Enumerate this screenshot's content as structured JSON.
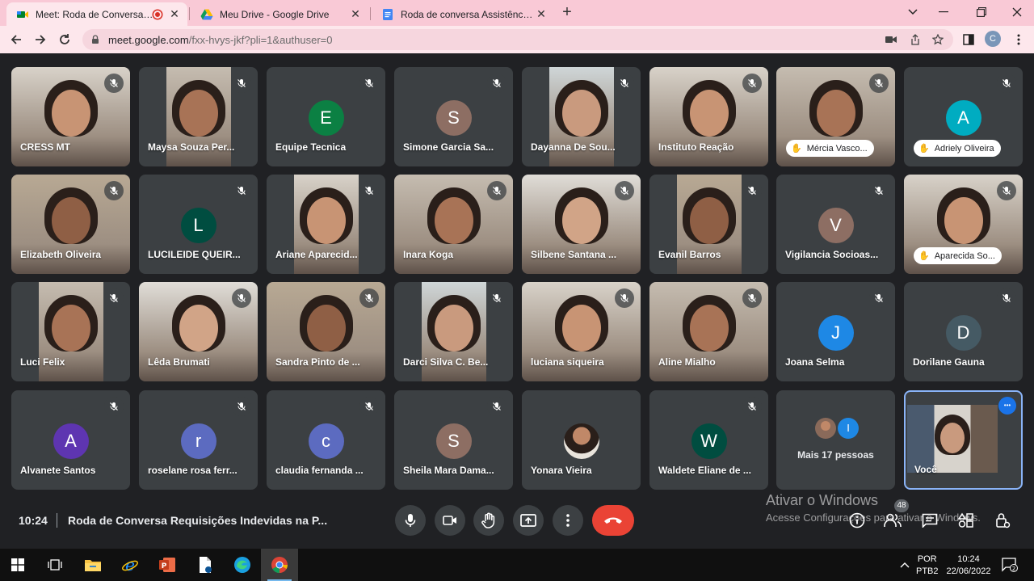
{
  "browser": {
    "tabs": [
      {
        "title": "Meet: Roda de Conversa Req",
        "active": true,
        "recording": true
      },
      {
        "title": "Meu Drive - Google Drive",
        "active": false
      },
      {
        "title": "Roda de conversa Assistência So",
        "active": false
      }
    ],
    "new_tab": "+",
    "url_host": "meet.google.com",
    "url_path": "/fxx-hvys-jkf?pli=1&authuser=0",
    "profile_initial": "C",
    "colors": {
      "tabbar": "#f9c9d6",
      "toolbar": "#fde7ec"
    }
  },
  "meeting": {
    "time": "10:24",
    "title": "Roda de Conversa Requisições Indevidas na P...",
    "people_count": "48",
    "more_people_label": "Mais 17 pessoas",
    "more_people_avatar_letter": "I",
    "self_label": "Você",
    "watermark_title": "Ativar o Windows",
    "watermark_sub": "Acesse Configurações para ativar o Windows."
  },
  "participants": [
    {
      "name": "CRESS MT",
      "type": "video",
      "muted": true
    },
    {
      "name": "Maysa Souza Per...",
      "type": "video",
      "muted": true
    },
    {
      "name": "Equipe Tecnica",
      "type": "initial",
      "initial": "E",
      "color": "#0b8043",
      "muted": true
    },
    {
      "name": "Simone Garcia Sa...",
      "type": "initial",
      "initial": "S",
      "color": "#8d6e63",
      "muted": true
    },
    {
      "name": "Dayanna De Sou...",
      "type": "video",
      "muted": true
    },
    {
      "name": "Instituto Reação",
      "type": "video",
      "muted": true
    },
    {
      "name": "Mércia Vasco...",
      "type": "video",
      "muted": true,
      "hand_raised": true
    },
    {
      "name": "Adriely Oliveira",
      "type": "initial",
      "initial": "A",
      "color": "#00acc1",
      "muted": true,
      "hand_raised": true
    },
    {
      "name": "Elizabeth Oliveira",
      "type": "video",
      "muted": true
    },
    {
      "name": "LUCILEIDE QUEIR...",
      "type": "initial",
      "initial": "L",
      "color": "#004d40",
      "muted": true
    },
    {
      "name": "Ariane Aparecid...",
      "type": "video",
      "muted": true
    },
    {
      "name": "Inara Koga",
      "type": "video",
      "muted": true
    },
    {
      "name": "Silbene Santana ...",
      "type": "video",
      "muted": true
    },
    {
      "name": "Evanil Barros",
      "type": "video",
      "muted": true
    },
    {
      "name": "Vigilancia Socioas...",
      "type": "initial",
      "initial": "V",
      "color": "#8d6e63",
      "muted": true
    },
    {
      "name": "Aparecida So...",
      "type": "video",
      "muted": true,
      "hand_raised": true
    },
    {
      "name": "Luci Felix",
      "type": "video",
      "muted": true
    },
    {
      "name": "Lêda Brumati",
      "type": "video",
      "muted": true
    },
    {
      "name": "Sandra Pinto de ...",
      "type": "video",
      "muted": true
    },
    {
      "name": "Darci Silva C. Be...",
      "type": "video",
      "muted": true
    },
    {
      "name": "luciana siqueira",
      "type": "video",
      "muted": true
    },
    {
      "name": "Aline Mialho",
      "type": "video",
      "muted": true
    },
    {
      "name": "Joana Selma",
      "type": "initial",
      "initial": "J",
      "color": "#1e88e5",
      "muted": true
    },
    {
      "name": "Dorilane Gauna",
      "type": "initial",
      "initial": "D",
      "color": "#455a64",
      "muted": true
    },
    {
      "name": "Alvanete Santos",
      "type": "initial",
      "initial": "A",
      "color": "#5e35b1",
      "muted": true
    },
    {
      "name": "roselane rosa ferr...",
      "type": "initial",
      "initial": "r",
      "color": "#5c6bc0",
      "muted": true
    },
    {
      "name": "claudia fernanda ...",
      "type": "initial",
      "initial": "c",
      "color": "#5c6bc0",
      "muted": true
    },
    {
      "name": "Sheila Mara Dama...",
      "type": "initial",
      "initial": "S",
      "color": "#8d6e63",
      "muted": true
    },
    {
      "name": "Yonara Vieira",
      "type": "photo",
      "muted": false
    },
    {
      "name": "Waldete Eliane de ...",
      "type": "initial",
      "initial": "W",
      "color": "#004d40",
      "muted": true
    }
  ],
  "taskbar": {
    "lang_1": "POR",
    "lang_2": "PTB2",
    "time": "10:24",
    "date": "22/06/2022",
    "notification_count": "2"
  }
}
